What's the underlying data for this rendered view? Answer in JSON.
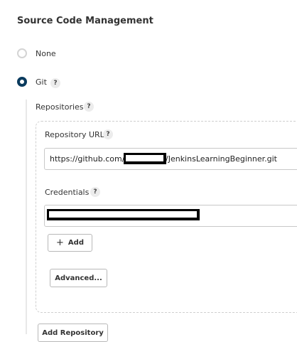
{
  "section": {
    "title": "Source Code Management"
  },
  "scm_options": [
    {
      "label": "None",
      "selected": false
    },
    {
      "label": "Git",
      "selected": true
    }
  ],
  "help_icon_glyph": "?",
  "repositories": {
    "label": "Repositories",
    "repository_url": {
      "label": "Repository URL",
      "value_prefix": "https://github.com/",
      "value_suffix": "/JenkinsLearningBeginner.git"
    },
    "credentials": {
      "label": "Credentials"
    },
    "add_button": {
      "icon": "plus-icon",
      "label": "Add"
    },
    "advanced_button": {
      "label": "Advanced..."
    }
  },
  "add_repository_button": {
    "label": "Add Repository"
  },
  "colors": {
    "radio_selected": "#0b3b5e",
    "radio_unselected_border": "#d4d4d4"
  }
}
